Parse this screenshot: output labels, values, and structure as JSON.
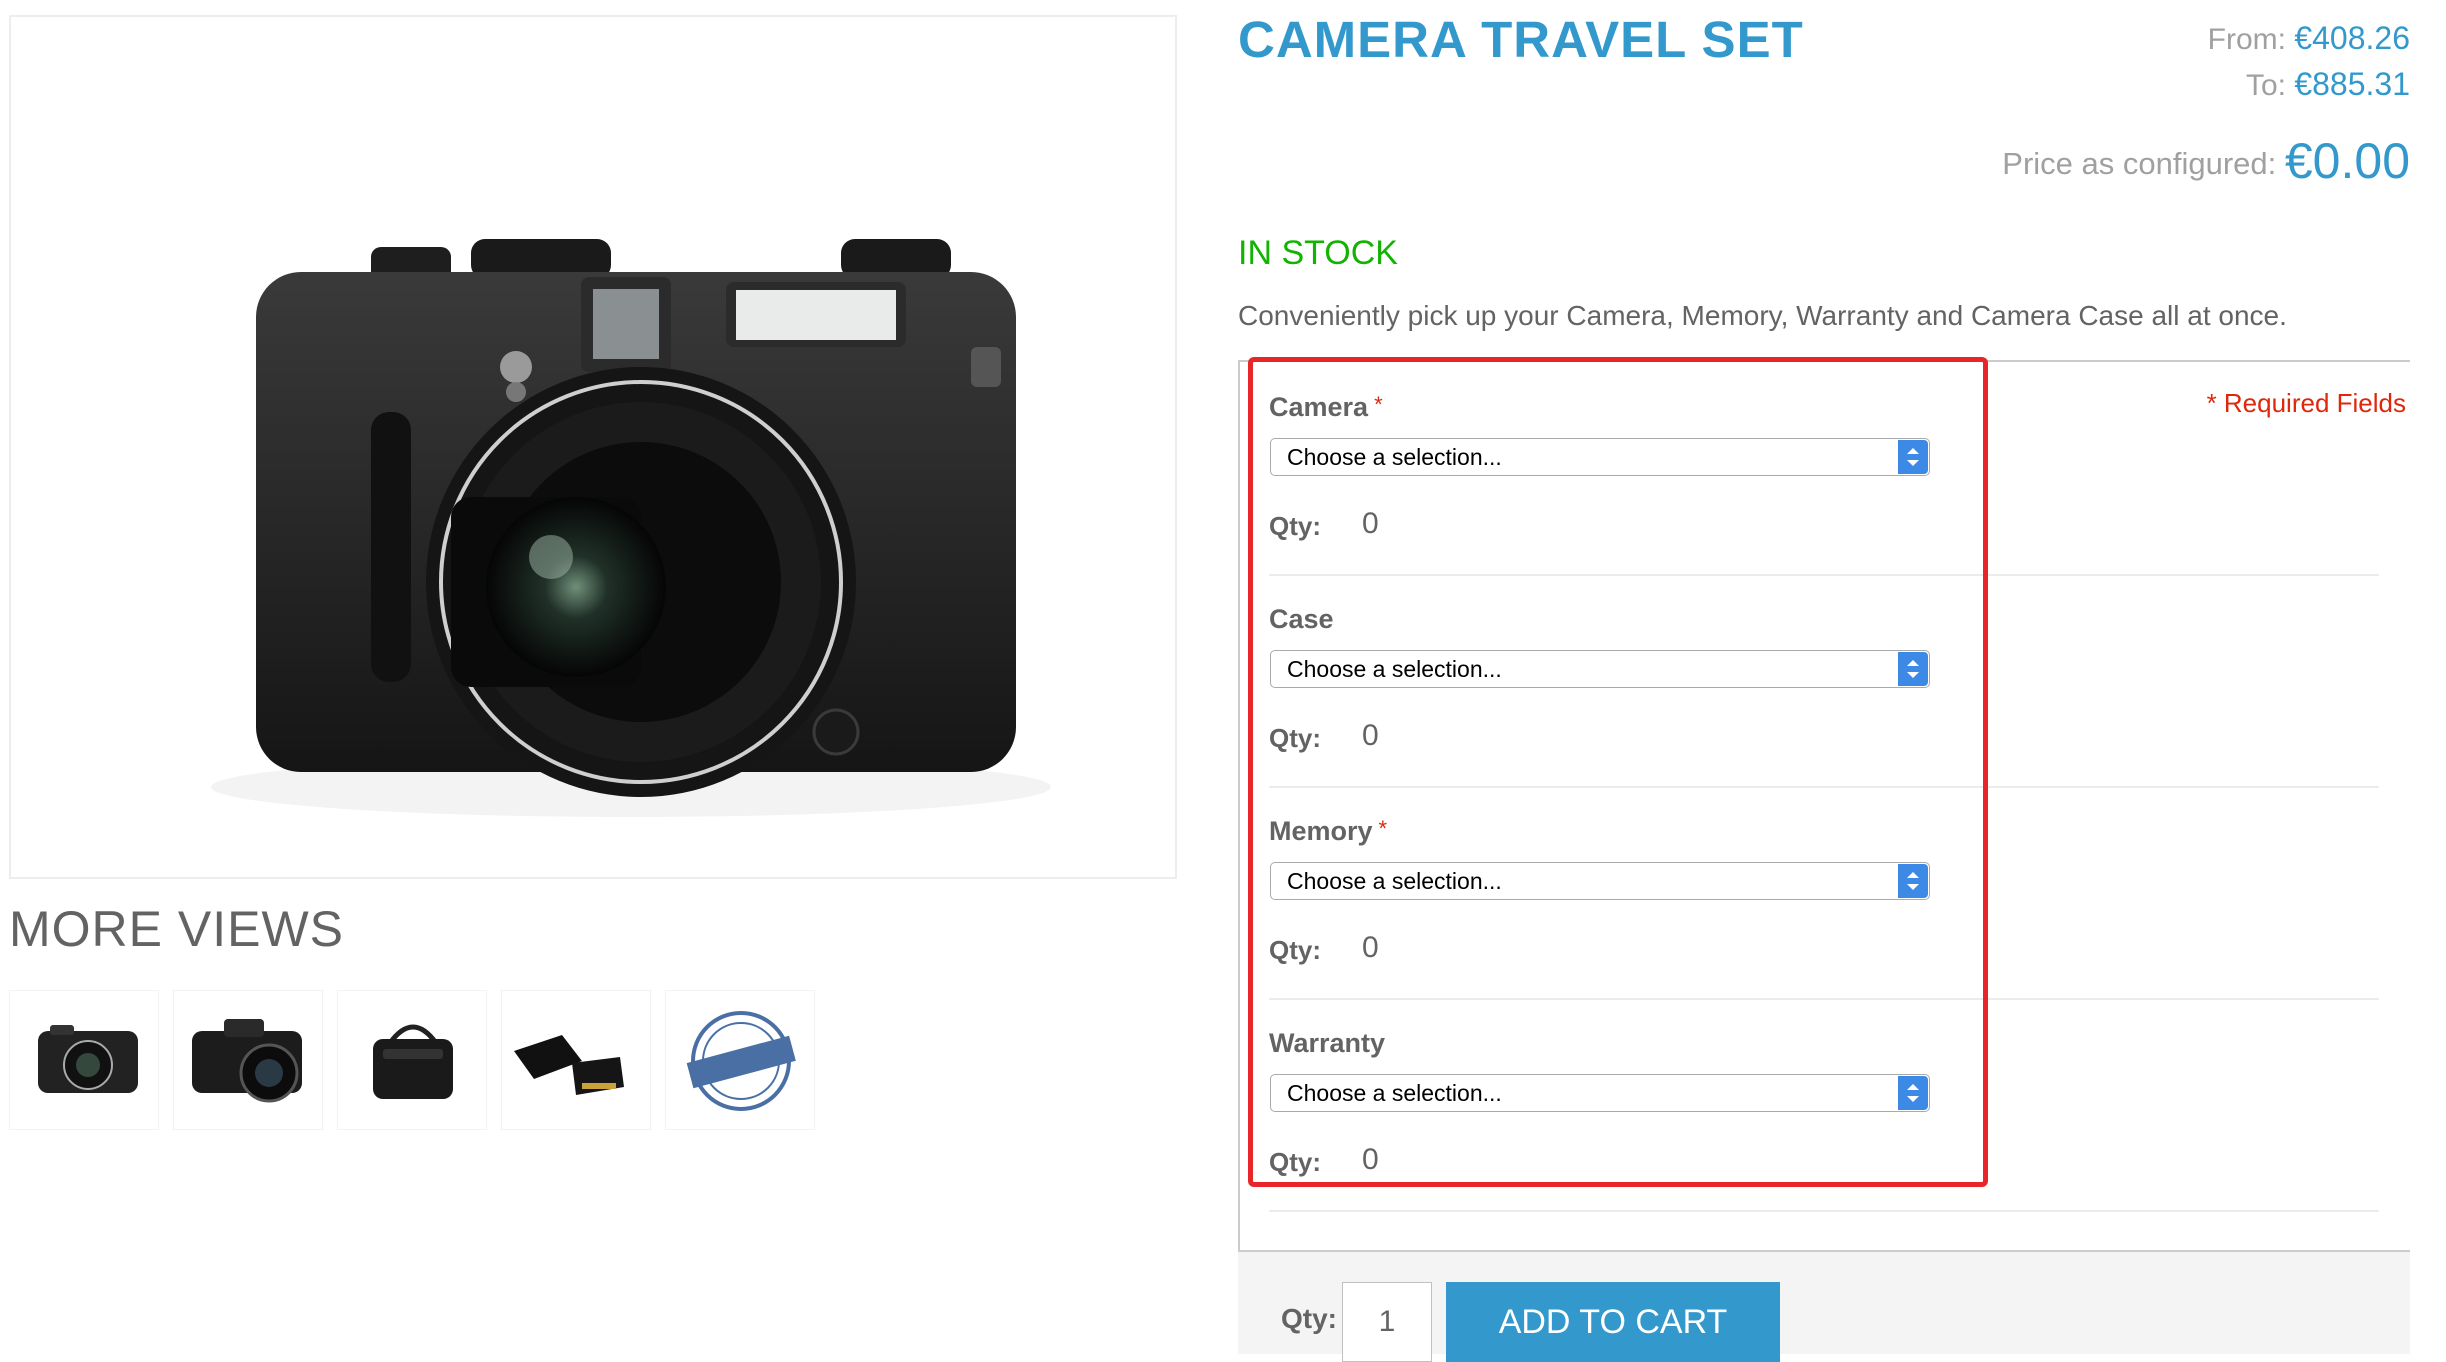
{
  "product": {
    "name": "CAMERA TRAVEL SET",
    "price_from_label": "From:",
    "price_from": "€408.26",
    "price_to_label": "To:",
    "price_to": "€885.31",
    "price_config_label": "Price as configured:",
    "price_config": "€0.00",
    "stock": "IN STOCK",
    "description": "Conveniently pick up your Camera, Memory, Warranty and Camera Case all at once."
  },
  "gallery": {
    "more_views_title": "MORE VIEWS",
    "thumbnails": [
      "compact-camera",
      "dslr-camera",
      "camera-bag",
      "memory-cards",
      "warranty-stamp"
    ]
  },
  "options": {
    "required_note": "* Required Fields",
    "items": [
      {
        "label": "Camera",
        "required": "*",
        "select": "Choose a selection...",
        "qty_label": "Qty:",
        "qty": "0"
      },
      {
        "label": "Case",
        "required": "",
        "select": "Choose a selection...",
        "qty_label": "Qty:",
        "qty": "0"
      },
      {
        "label": "Memory",
        "required": "*",
        "select": "Choose a selection...",
        "qty_label": "Qty:",
        "qty": "0"
      },
      {
        "label": "Warranty",
        "required": "",
        "select": "Choose a selection...",
        "qty_label": "Qty:",
        "qty": "0"
      }
    ]
  },
  "cart": {
    "qty_label": "Qty:",
    "qty_value": "1",
    "button": "ADD TO CART"
  },
  "colors": {
    "accent": "#3399cc",
    "in_stock": "#11b400",
    "required": "#df280a",
    "highlight": "#e8262a"
  }
}
